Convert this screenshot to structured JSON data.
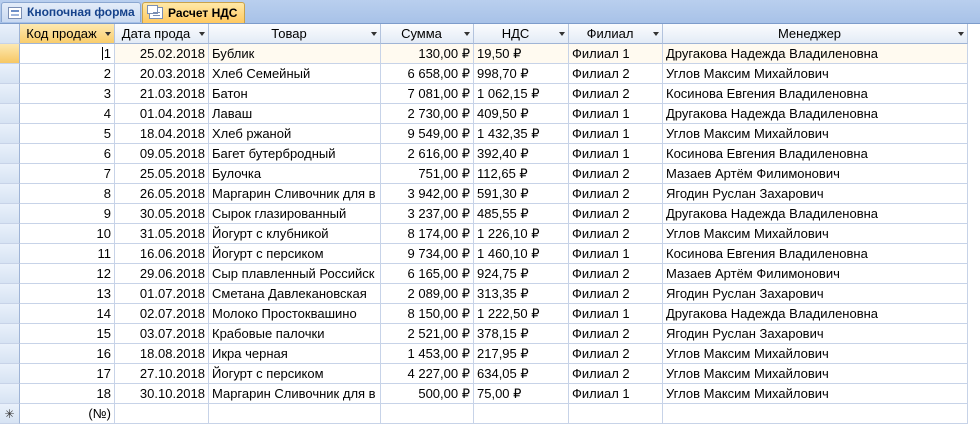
{
  "tabs": [
    {
      "label": "Кнопочная форма",
      "icon": "form-icon",
      "active": false
    },
    {
      "label": "Расчет НДС",
      "icon": "query-icon",
      "active": true
    }
  ],
  "columns": [
    "Код продаж",
    "Дата прода",
    "Товар",
    "Сумма",
    "НДС",
    "Филиал",
    "Менеджер"
  ],
  "rows": [
    {
      "id": "1",
      "date": "25.02.2018",
      "product": "Бублик",
      "sum": "130,00 ₽",
      "vat": "19,50 ₽",
      "branch": "Филиал 1",
      "manager": "Другакова Надежда Владиленовна"
    },
    {
      "id": "2",
      "date": "20.03.2018",
      "product": "Хлеб Семейный",
      "sum": "6 658,00 ₽",
      "vat": "998,70 ₽",
      "branch": "Филиал 2",
      "manager": "Углов Максим Михайлович"
    },
    {
      "id": "3",
      "date": "21.03.2018",
      "product": "Батон",
      "sum": "7 081,00 ₽",
      "vat": "1 062,15 ₽",
      "branch": "Филиал 2",
      "manager": "Косинова Евгения Владиленовна"
    },
    {
      "id": "4",
      "date": "01.04.2018",
      "product": "Лаваш",
      "sum": "2 730,00 ₽",
      "vat": "409,50 ₽",
      "branch": "Филиал 1",
      "manager": "Другакова Надежда Владиленовна"
    },
    {
      "id": "5",
      "date": "18.04.2018",
      "product": "Хлеб ржаной",
      "sum": "9 549,00 ₽",
      "vat": "1 432,35 ₽",
      "branch": "Филиал 1",
      "manager": "Углов Максим Михайлович"
    },
    {
      "id": "6",
      "date": "09.05.2018",
      "product": "Багет бутербродный",
      "sum": "2 616,00 ₽",
      "vat": "392,40 ₽",
      "branch": "Филиал 1",
      "manager": "Косинова Евгения Владиленовна"
    },
    {
      "id": "7",
      "date": "25.05.2018",
      "product": "Булочка",
      "sum": "751,00 ₽",
      "vat": "112,65 ₽",
      "branch": "Филиал 2",
      "manager": "Мазаев Артём Филимонович"
    },
    {
      "id": "8",
      "date": "26.05.2018",
      "product": "Маргарин Сливочник для в",
      "sum": "3 942,00 ₽",
      "vat": "591,30 ₽",
      "branch": "Филиал 2",
      "manager": "Ягодин Руслан Захарович"
    },
    {
      "id": "9",
      "date": "30.05.2018",
      "product": "Сырок глазированный",
      "sum": "3 237,00 ₽",
      "vat": "485,55 ₽",
      "branch": "Филиал 2",
      "manager": "Другакова Надежда Владиленовна"
    },
    {
      "id": "10",
      "date": "31.05.2018",
      "product": "Йогурт с клубникой",
      "sum": "8 174,00 ₽",
      "vat": "1 226,10 ₽",
      "branch": "Филиал 2",
      "manager": "Углов Максим Михайлович"
    },
    {
      "id": "11",
      "date": "16.06.2018",
      "product": "Йогурт с персиком",
      "sum": "9 734,00 ₽",
      "vat": "1 460,10 ₽",
      "branch": "Филиал 1",
      "manager": "Косинова Евгения Владиленовна"
    },
    {
      "id": "12",
      "date": "29.06.2018",
      "product": "Сыр плавленный Российск",
      "sum": "6 165,00 ₽",
      "vat": "924,75 ₽",
      "branch": "Филиал 2",
      "manager": "Мазаев Артём Филимонович"
    },
    {
      "id": "13",
      "date": "01.07.2018",
      "product": "Сметана Давлекановская",
      "sum": "2 089,00 ₽",
      "vat": "313,35 ₽",
      "branch": "Филиал 2",
      "manager": "Ягодин Руслан Захарович"
    },
    {
      "id": "14",
      "date": "02.07.2018",
      "product": "Молоко Простоквашино",
      "sum": "8 150,00 ₽",
      "vat": "1 222,50 ₽",
      "branch": "Филиал 1",
      "manager": "Другакова Надежда Владиленовна"
    },
    {
      "id": "15",
      "date": "03.07.2018",
      "product": "Крабовые палочки",
      "sum": "2 521,00 ₽",
      "vat": "378,15 ₽",
      "branch": "Филиал 2",
      "manager": "Ягодин Руслан Захарович"
    },
    {
      "id": "16",
      "date": "18.08.2018",
      "product": "Икра черная",
      "sum": "1 453,00 ₽",
      "vat": "217,95 ₽",
      "branch": "Филиал 2",
      "manager": "Углов Максим Михайлович"
    },
    {
      "id": "17",
      "date": "27.10.2018",
      "product": "Йогурт с персиком",
      "sum": "4 227,00 ₽",
      "vat": "634,05 ₽",
      "branch": "Филиал 2",
      "manager": "Углов Максим Михайлович"
    },
    {
      "id": "18",
      "date": "30.10.2018",
      "product": "Маргарин Сливочник для в",
      "sum": "500,00 ₽",
      "vat": "75,00 ₽",
      "branch": "Филиал 1",
      "manager": "Углов Максим Михайлович"
    }
  ],
  "new_row": {
    "marker": "✳",
    "id_placeholder": "(№)"
  }
}
